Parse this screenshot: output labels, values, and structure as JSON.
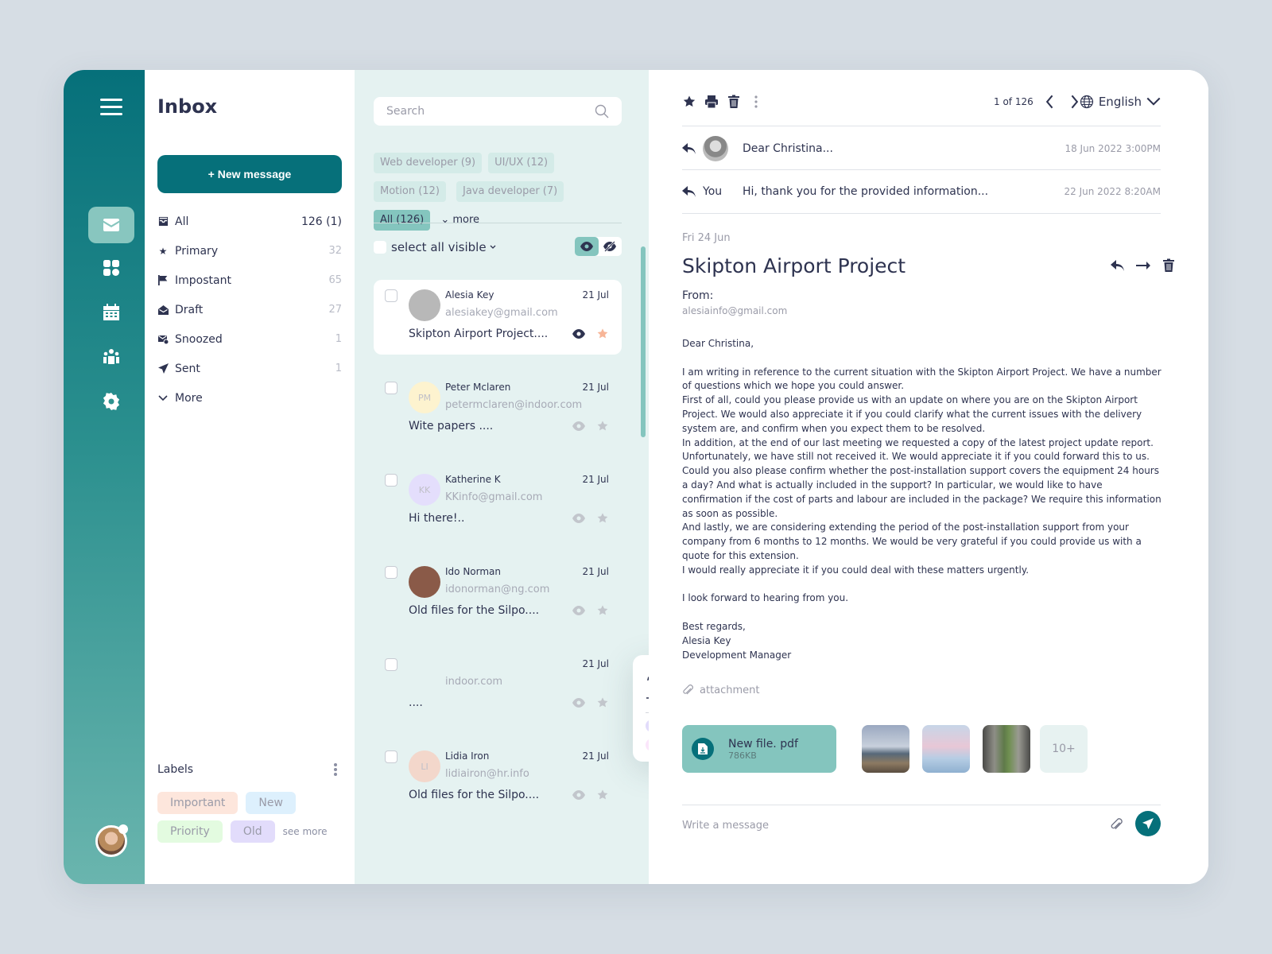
{
  "rail": {
    "items": [
      {
        "name": "mail",
        "active": true
      },
      {
        "name": "dashboard",
        "active": false
      },
      {
        "name": "calendar",
        "active": false
      },
      {
        "name": "team",
        "active": false
      },
      {
        "name": "settings",
        "active": false
      }
    ]
  },
  "folders": {
    "title": "Inbox",
    "new_message": "+ New message",
    "items": [
      {
        "label": "All",
        "count": "126 (1)",
        "icon": "inbox-icon"
      },
      {
        "label": "Primary",
        "count": "32",
        "icon": "star-icon"
      },
      {
        "label": "Impostant",
        "count": "65",
        "icon": "flag-icon"
      },
      {
        "label": "Draft",
        "count": "27",
        "icon": "envelope-open-icon"
      },
      {
        "label": "Snoozed",
        "count": "1",
        "icon": "snooze-icon"
      },
      {
        "label": "Sent",
        "count": "1",
        "icon": "send-icon"
      },
      {
        "label": "More",
        "count": "",
        "icon": "chevron-down-icon"
      }
    ],
    "labels_title": "Labels",
    "labels": [
      {
        "label": "Important",
        "color": "#fde6dc"
      },
      {
        "label": "New",
        "color": "#ddf0fd"
      },
      {
        "label": "Priority",
        "color": "#e3fbe0"
      },
      {
        "label": "Old",
        "color": "#e2dcfb"
      }
    ],
    "see_more": "see more"
  },
  "list": {
    "search_placeholder": "Search",
    "tags": [
      {
        "label": "Web developer (9)",
        "active": false
      },
      {
        "label": "UI/UX (12)",
        "active": false
      },
      {
        "label": "Motion (12)",
        "active": false
      },
      {
        "label": "Java developer (7)",
        "active": false
      },
      {
        "label": "All (126)",
        "active": true
      }
    ],
    "more": "more",
    "select_all": "select all visible",
    "mails": [
      {
        "name": "Alesia Key",
        "email": "alesiakey@gmail.com",
        "date": "21 Jul",
        "subject": "Skipton Airport Project....",
        "initials": "",
        "avatar_color": "#b8b8b8",
        "selected": true,
        "starred": true
      },
      {
        "name": "Peter Mclaren",
        "email": "petermclaren@indoor.com",
        "date": "21 Jul",
        "subject": "Wite papers ....",
        "initials": "PM",
        "avatar_color": "#fdf3cf",
        "selected": false,
        "starred": false
      },
      {
        "name": "Katherine K",
        "email": "KKinfo@gmail.com",
        "date": "21 Jul",
        "subject": "Hi there!..",
        "initials": "KK",
        "avatar_color": "#e4defc",
        "selected": false,
        "starred": false
      },
      {
        "name": "Ido Norman",
        "email": "idonorman@ng.com",
        "date": "21 Jul",
        "subject": "Old files for the Silpo....",
        "initials": "",
        "avatar_color": "#8a5a48",
        "selected": false,
        "starred": false
      },
      {
        "name": "",
        "email": "indoor.com",
        "date": "21 Jul",
        "subject": "....",
        "initials": "",
        "avatar_color": "#e5f2f1",
        "selected": false,
        "starred": false
      },
      {
        "name": "Lidia Iron",
        "email": "lidiairon@hr.info",
        "date": "21 Jul",
        "subject": "Old files for the Silpo....",
        "initials": "LI",
        "avatar_color": "#f3d7cb",
        "selected": false,
        "starred": false
      }
    ]
  },
  "popup": {
    "edit": "Edit",
    "add_new": "Add new",
    "swatches": [
      "#e2dcfb",
      "#ddf0fd",
      "#f1cab5",
      "#d9f8cf",
      "#fdf0b6",
      "#d3e6e3",
      "#e2e4ab",
      "#fbe6fb",
      "#a9eaef",
      "#b9cbfb",
      "#e08a8a",
      "#fd9bbf",
      "#f7a578"
    ]
  },
  "reader": {
    "pager": "1 of 126",
    "language": "English",
    "thread": [
      {
        "who": "",
        "text": "Dear Christina...",
        "time": "18 Jun 2022  3:00PM",
        "has_avatar": true
      },
      {
        "who": "You",
        "text": "Hi, thank you for the provided information...",
        "time": "22 Jun 2022  8:20AM",
        "has_avatar": false
      }
    ],
    "date": "Fri 24 Jun",
    "subject": "Skipton Airport Project",
    "from_label": "From:",
    "from_email": "alesiainfo@gmail.com",
    "body": [
      "Dear Christina,",
      "",
      "I am writing in reference to the current situation with the Skipton Airport Project. We have a number of questions which we hope you could answer.",
      "First of all, could you please provide us with an update on where you are on the Skipton Airport Project. We would also appreciate it if you could clarify what the current issues with the delivery system are, and confirm when you expect them to be resolved.",
      "In addition, at the end of our last meeting we requested a copy of the latest project update report. Unfortunately, we have still not received it. We would appreciate it if you could forward this to us.",
      "Could you also please confirm whether the post-installation support covers the equipment 24 hours a day? And what is actually included in the support? In particular, we would like to have confirmation if the cost of parts and labour are included in the package? We require this information as soon as possible.",
      "And lastly, we are considering extending the period of the post-installation support from your company from 6 months to 12 months. We would be very grateful if you could provide us with a quote for this extension.",
      "I would really appreciate it if you could deal with these matters urgently.",
      "",
      "I look forward to hearing from you.",
      "",
      "Best regards,",
      "Alesia Key",
      "Development Manager"
    ],
    "attachment_label": "attachment",
    "file_name": "New file. pdf",
    "file_size": "786KB",
    "more_attachments": "10+",
    "compose_placeholder": "Write a message"
  }
}
